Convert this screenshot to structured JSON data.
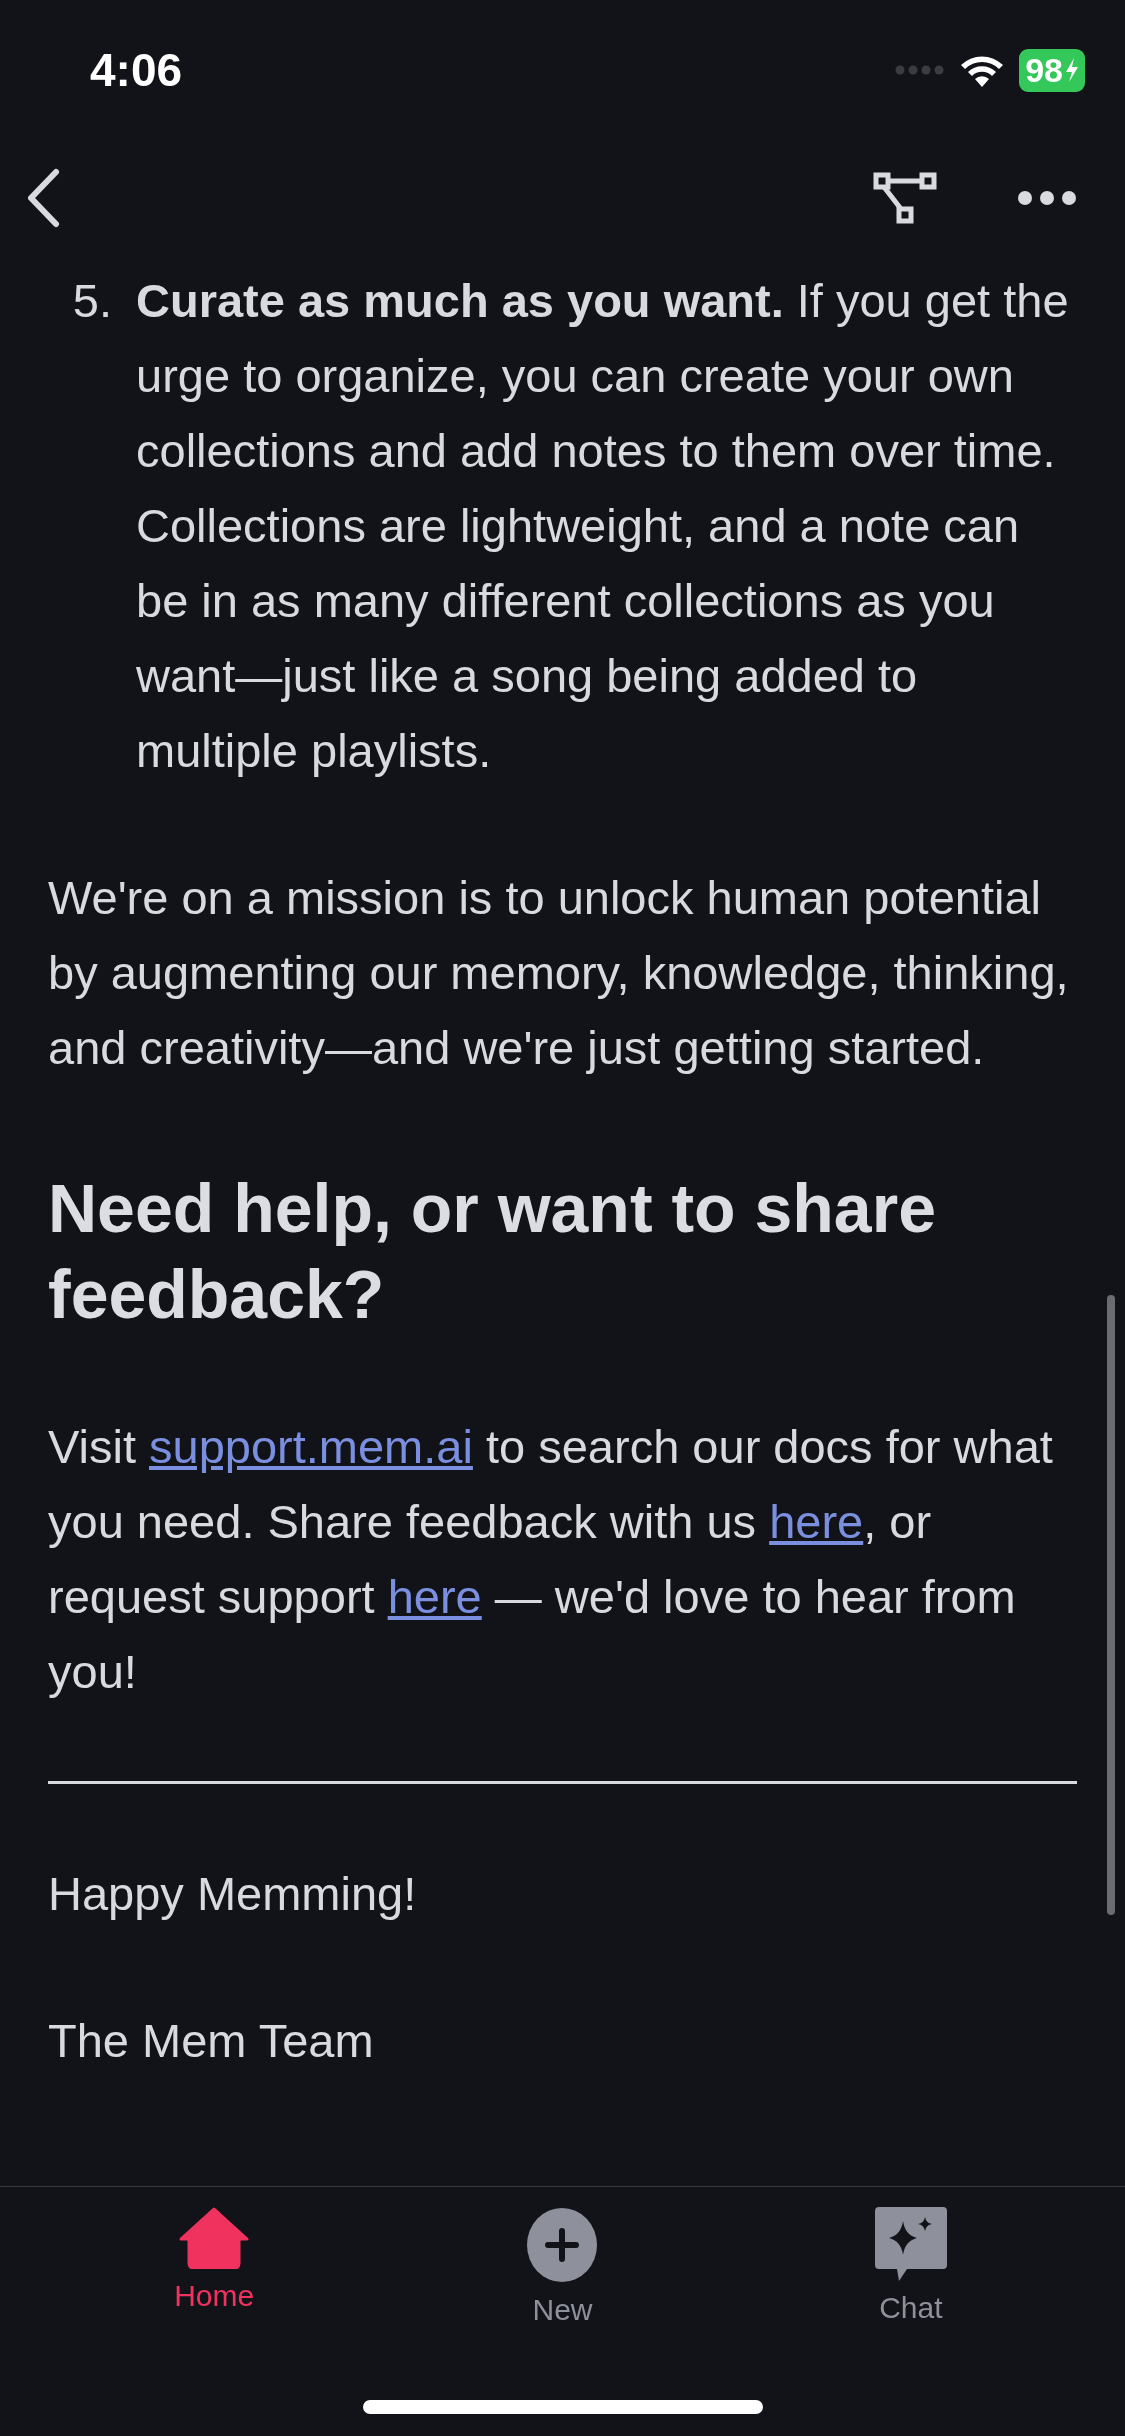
{
  "status_bar": {
    "time": "4:06",
    "battery": "98"
  },
  "content": [
    {
      "kind": "list_item",
      "number": "5.",
      "text": "**Curate as much as you want.** If you get the urge to organize, you can create your own collections and add notes to them over time. Collections are lightweight, and a note can be in as many different collections as you want—just like a song being added to multiple playlists."
    },
    {
      "kind": "paragraph",
      "parts": [
        {
          "text": "We're on a mission is to unlock human potential by augmenting our memory, knowledge, thinking, and creativity—and we're just getting started.",
          "kind": "text"
        }
      ]
    },
    {
      "kind": "heading",
      "text": "Need help, or want to share feedback?"
    },
    {
      "kind": "paragraph",
      "parts": [
        {
          "text": "Visit ",
          "kind": "text"
        },
        {
          "text": "support.mem.ai",
          "kind": "link"
        },
        {
          "text": " to search our docs for what you need. Share feedback with us ",
          "kind": "text"
        },
        {
          "text": "here",
          "kind": "link"
        },
        {
          "text": ", or request support ",
          "kind": "text"
        },
        {
          "text": "here",
          "kind": "link"
        },
        {
          "text": " — we'd love to hear from you!",
          "kind": "text"
        }
      ]
    },
    {
      "kind": "divider"
    },
    {
      "kind": "paragraph",
      "parts": [
        {
          "text": "Happy Memming!",
          "kind": "text"
        }
      ]
    },
    {
      "kind": "paragraph",
      "parts": [
        {
          "text": "The Mem Team",
          "kind": "text"
        }
      ]
    }
  ],
  "tab_bar": [
    {
      "label": "Home",
      "selected": true
    },
    {
      "label": "New",
      "selected": false
    },
    {
      "label": "Chat",
      "selected": false
    }
  ]
}
